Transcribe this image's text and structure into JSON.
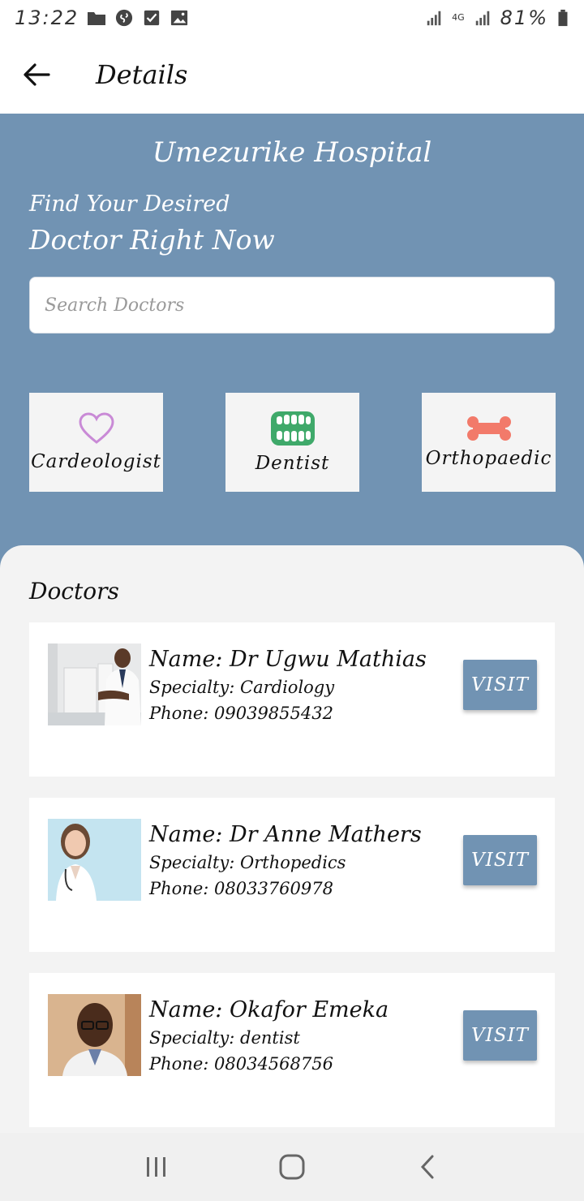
{
  "status_bar": {
    "time": "13:22",
    "network": "4G",
    "battery": "81%",
    "icons": [
      "folder-icon",
      "shazam-icon",
      "checkbox-icon",
      "image-icon",
      "signal-icon",
      "battery-icon"
    ]
  },
  "app_bar": {
    "title": "Details",
    "back_icon": "arrow-left-icon"
  },
  "hero": {
    "hospital_name": "Umezurike Hospital",
    "find_line": "Find Your Desired",
    "doctor_line": "Doctor Right Now",
    "search_placeholder": "Search Doctors",
    "search_value": ""
  },
  "categories": [
    {
      "label": "Cardeologist",
      "icon": "heart-icon",
      "color": "#c98ad6"
    },
    {
      "label": "Dentist",
      "icon": "teeth-icon",
      "color": "#3fa96a"
    },
    {
      "label": "Orthopaedic",
      "icon": "bone-icon",
      "color": "#f27a6a"
    }
  ],
  "doctors_section": {
    "title": "Doctors",
    "doctors": [
      {
        "name": "Name: Dr Ugwu Mathias",
        "specialty": "Specialty: Cardiology",
        "phone": "Phone: 09039855432",
        "visit_label": "VISIT"
      },
      {
        "name": "Name: Dr Anne Mathers",
        "specialty": "Specialty: Orthopedics",
        "phone": "Phone: 08033760978",
        "visit_label": "VISIT"
      },
      {
        "name": "Name:  Okafor Emeka",
        "specialty": "Specialty: dentist",
        "phone": "Phone: 08034568756",
        "visit_label": "VISIT"
      }
    ]
  },
  "nav_bar": {
    "icons": [
      "recent-apps-icon",
      "home-icon",
      "back-icon"
    ]
  },
  "colors": {
    "primary": "#7193b3",
    "background": "#f3f3f3",
    "card": "#ffffff"
  }
}
